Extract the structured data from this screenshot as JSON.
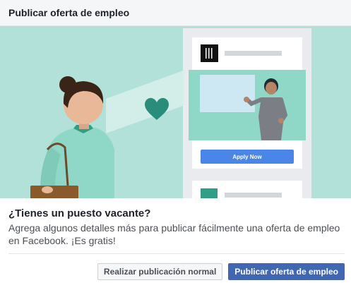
{
  "dialog": {
    "title": "Publicar oferta de empleo"
  },
  "illustration": {
    "apply_button_label": "Apply Now",
    "colors": {
      "background": "#b2e1d9",
      "phone_frame": "#e9ebee",
      "card": "#ffffff",
      "teal": "#2e9e87",
      "heart": "#2a8c7a",
      "button": "#4a86e8"
    }
  },
  "content": {
    "question": "¿Tienes un puesto vacante?",
    "description": "Agrega algunos detalles más para publicar fácilmente una oferta de empleo en Facebook. ¡Es gratis!"
  },
  "footer": {
    "secondary_label": "Realizar publicación normal",
    "primary_label": "Publicar oferta de empleo"
  }
}
